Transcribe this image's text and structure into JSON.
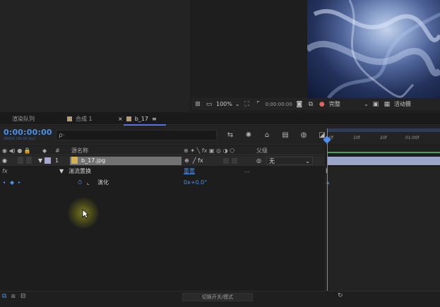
{
  "viewer": {
    "zoom": "100%",
    "timecode": "0:00:00:00",
    "resolution": "完整",
    "active_camera": "活动摄"
  },
  "tabs": [
    {
      "label": "渲染队列"
    },
    {
      "label": "合成 1"
    },
    {
      "label": "b_17",
      "menu": "≡"
    }
  ],
  "timeline": {
    "timecode": "0:00:00:00",
    "fps": "00000 (30.00 fps)",
    "search_placeholder": "ρ·",
    "columns": {
      "num": "#",
      "source_name": "源名称",
      "parent": "父级"
    },
    "layer": {
      "number": "1",
      "name": "b_17.jpg",
      "parent_value": "无"
    },
    "effect": {
      "fx": "fx",
      "name": "湍流置换",
      "reset": "重置",
      "more": "..."
    },
    "property": {
      "name": "演化",
      "value": "0x+0.0°"
    },
    "ruler": [
      "0f",
      "10f",
      "20f",
      "01:00f"
    ],
    "mode_toggle": "切换开关/模式"
  },
  "colors": {
    "accent": "#4e8ff0",
    "timecode": "#4d8ee6",
    "layer_bar": "#9aa6c9",
    "label_swatch": "#b79b72"
  }
}
